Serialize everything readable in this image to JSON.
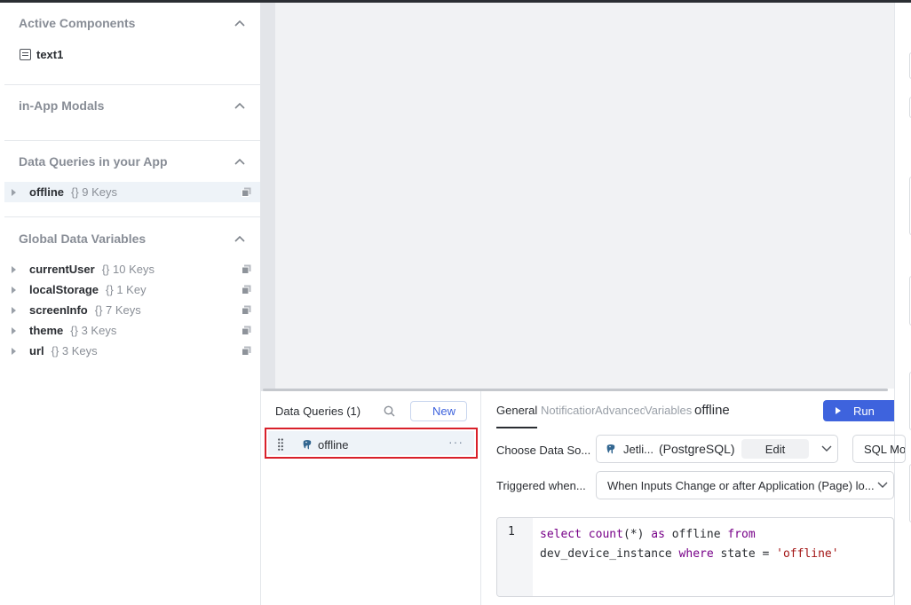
{
  "left_panel": {
    "active_components": {
      "title": "Active Components",
      "items": [
        {
          "name": "text1",
          "icon": "text-icon"
        }
      ]
    },
    "modals": {
      "title": "in-App Modals"
    },
    "data_queries": {
      "title": "Data Queries in your App",
      "items": [
        {
          "name": "offline",
          "keys": "{} 9 Keys"
        }
      ]
    },
    "global_vars": {
      "title": "Global Data Variables",
      "items": [
        {
          "name": "currentUser",
          "keys": "{} 10 Keys"
        },
        {
          "name": "localStorage",
          "keys": "{} 1 Key"
        },
        {
          "name": "screenInfo",
          "keys": "{} 7 Keys"
        },
        {
          "name": "theme",
          "keys": "{} 3 Keys"
        },
        {
          "name": "url",
          "keys": "{} 3 Keys"
        }
      ]
    }
  },
  "query_list": {
    "header": "Data Queries (1)",
    "new_label": "New",
    "items": [
      {
        "name": "offline",
        "icon": "postgres-icon"
      }
    ],
    "more": "···"
  },
  "editor": {
    "tabs": [
      "General",
      "Notifications",
      "Advanced",
      "Variables"
    ],
    "query_title": "offline",
    "run_label": "Run",
    "datasource_label": "Choose Data So...",
    "datasource_name": "Jetli...",
    "datasource_type": "(PostgreSQL)",
    "edit_label": "Edit",
    "sql_mode": "SQL Mode",
    "trigger_label": "Triggered when...",
    "trigger_value": "When Inputs Change or after Application (Page) lo...",
    "line_number": "1",
    "code_line1": {
      "kw1": "select",
      "fn": "count",
      "rest1": "(*) ",
      "kw2": "as",
      "ident": " offline ",
      "kw3": "from"
    },
    "code_line2": {
      "ident": "dev_device_instance ",
      "kw": "where",
      "mid": " state = ",
      "str": "'offline'"
    }
  },
  "colors": {
    "accent": "#3e63dd",
    "highlight_border": "#d9202a",
    "selected_bg": "#eef3f8"
  }
}
